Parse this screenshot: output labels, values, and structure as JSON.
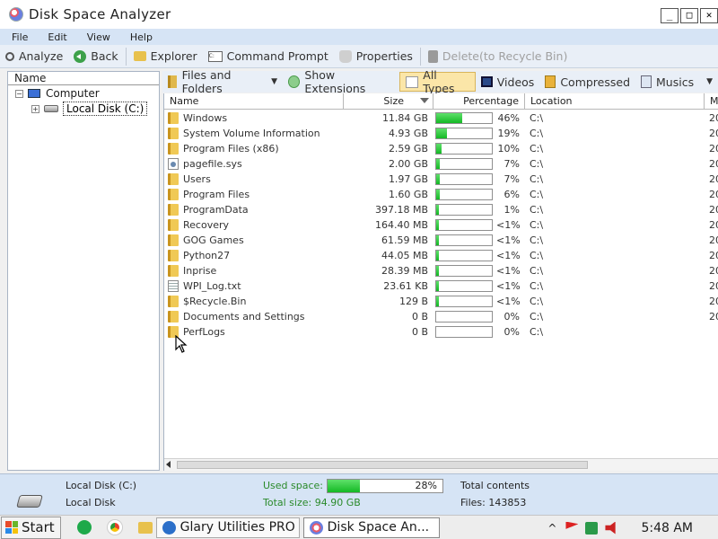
{
  "window": {
    "title": "Disk Space Analyzer"
  },
  "menu": [
    "File",
    "Edit",
    "View",
    "Help"
  ],
  "toolbar": {
    "analyze": "Analyze",
    "back": "Back",
    "explorer": "Explorer",
    "command_prompt": "Command Prompt",
    "properties": "Properties",
    "delete": "Delete(to Recycle Bin)"
  },
  "tree": {
    "header": "Name",
    "computer": "Computer",
    "local_disk": "Local Disk (C:)"
  },
  "filters": {
    "files_and_folders": "Files and Folders",
    "show_extensions": "Show Extensions",
    "all_types": "All Types",
    "videos": "Videos",
    "compressed": "Compressed",
    "musics": "Musics"
  },
  "columns": {
    "name": "Name",
    "size": "Size",
    "percentage": "Percentage",
    "location": "Location",
    "modified": "Mo"
  },
  "rows": [
    {
      "name": "Windows",
      "type": "folder",
      "size": "11.84 GB",
      "pct_text": "46%",
      "pct": 46,
      "location": "C:\\",
      "modified": "20"
    },
    {
      "name": "System Volume Information",
      "type": "folder",
      "size": "4.93 GB",
      "pct_text": "19%",
      "pct": 19,
      "location": "C:\\",
      "modified": "20"
    },
    {
      "name": "Program Files (x86)",
      "type": "folder",
      "size": "2.59 GB",
      "pct_text": "10%",
      "pct": 10,
      "location": "C:\\",
      "modified": "20"
    },
    {
      "name": "pagefile.sys",
      "type": "sysfile",
      "size": "2.00 GB",
      "pct_text": "7%",
      "pct": 7,
      "location": "C:\\",
      "modified": "20"
    },
    {
      "name": "Users",
      "type": "folder",
      "size": "1.97 GB",
      "pct_text": "7%",
      "pct": 7,
      "location": "C:\\",
      "modified": "20"
    },
    {
      "name": "Program Files",
      "type": "folder",
      "size": "1.60 GB",
      "pct_text": "6%",
      "pct": 6,
      "location": "C:\\",
      "modified": "20"
    },
    {
      "name": "ProgramData",
      "type": "folder",
      "size": "397.18 MB",
      "pct_text": "1%",
      "pct": 1,
      "location": "C:\\",
      "modified": "20"
    },
    {
      "name": "Recovery",
      "type": "folder",
      "size": "164.40 MB",
      "pct_text": "<1%",
      "pct": 0.5,
      "location": "C:\\",
      "modified": "20"
    },
    {
      "name": "GOG Games",
      "type": "folder",
      "size": "61.59 MB",
      "pct_text": "<1%",
      "pct": 0.5,
      "location": "C:\\",
      "modified": "20"
    },
    {
      "name": "Python27",
      "type": "folder",
      "size": "44.05 MB",
      "pct_text": "<1%",
      "pct": 0.5,
      "location": "C:\\",
      "modified": "20"
    },
    {
      "name": "Inprise",
      "type": "folder",
      "size": "28.39 MB",
      "pct_text": "<1%",
      "pct": 0.5,
      "location": "C:\\",
      "modified": "20"
    },
    {
      "name": "WPI_Log.txt",
      "type": "txt",
      "size": "23.61 KB",
      "pct_text": "<1%",
      "pct": 0.5,
      "location": "C:\\",
      "modified": "20"
    },
    {
      "name": "$Recycle.Bin",
      "type": "folder",
      "size": "129 B",
      "pct_text": "<1%",
      "pct": 0.5,
      "location": "C:\\",
      "modified": "20"
    },
    {
      "name": "Documents and Settings",
      "type": "folder",
      "size": "0 B",
      "pct_text": "0%",
      "pct": 0,
      "location": "C:\\",
      "modified": "20"
    },
    {
      "name": "PerfLogs",
      "type": "folder",
      "size": "0 B",
      "pct_text": "0%",
      "pct": 0,
      "location": "C:\\",
      "modified": ""
    }
  ],
  "status": {
    "disk_name": "Local Disk (C:)",
    "disk_type": "Local Disk",
    "used_label": "Used space:",
    "used_pct_text": "28%",
    "used_pct": 28,
    "total_size": "Total size: 94.90 GB",
    "total_contents": "Total contents",
    "files": "Files: 143853"
  },
  "taskbar": {
    "start": "Start",
    "task1": "Glary Utilities PRO",
    "task2": "Disk Space An...",
    "clock": "5:48 AM"
  },
  "colors": {
    "accent_green": "#14b925",
    "menu_blue": "#d6e4f5",
    "active_filter": "#fbe6a8"
  }
}
